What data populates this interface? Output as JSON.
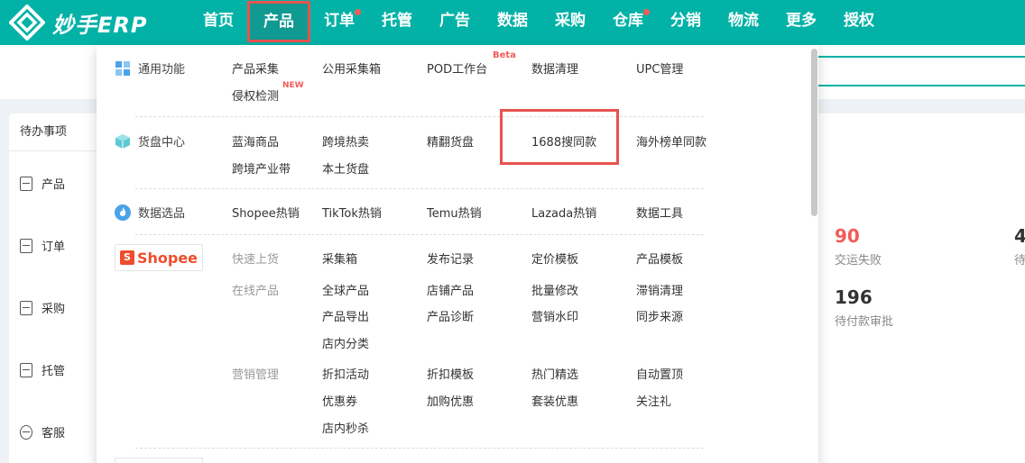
{
  "app": {
    "name": "妙手ERP"
  },
  "nav": [
    {
      "label": "首页",
      "active": false,
      "dot": false
    },
    {
      "label": "产品",
      "active": true,
      "dot": false
    },
    {
      "label": "订单",
      "active": false,
      "dot": true
    },
    {
      "label": "托管",
      "active": false,
      "dot": false
    },
    {
      "label": "广告",
      "active": false,
      "dot": false
    },
    {
      "label": "数据",
      "active": false,
      "dot": false
    },
    {
      "label": "采购",
      "active": false,
      "dot": false
    },
    {
      "label": "仓库",
      "active": false,
      "dot": true
    },
    {
      "label": "分销",
      "active": false,
      "dot": false
    },
    {
      "label": "物流",
      "active": false,
      "dot": false
    },
    {
      "label": "更多",
      "active": false,
      "dot": false
    },
    {
      "label": "授权",
      "active": false,
      "dot": false
    }
  ],
  "background": {
    "todo_title": "待办事项",
    "sidebar": [
      "产品",
      "订单",
      "采购",
      "托管",
      "客服"
    ],
    "stats": [
      {
        "value": "90",
        "label": "交运失败"
      },
      {
        "value": "4",
        "label": "待"
      },
      {
        "value": "196",
        "label": "待付款审批"
      }
    ]
  },
  "dropdown": {
    "categories": {
      "general": "通用功能",
      "supply": "货盘中心",
      "selection": "数据选品",
      "shopee": "Shopee"
    },
    "general_links": [
      "产品采集",
      "公用采集箱",
      "POD工作台",
      "数据清理",
      "UPC管理",
      "侵权检测"
    ],
    "badges": {
      "beta": "Beta",
      "new": "NEW"
    },
    "supply_links": [
      "蓝海商品",
      "跨境热卖",
      "精翻货盘",
      "1688搜同款",
      "海外榜单同款",
      "跨境产业带",
      "本土货盘"
    ],
    "selection_links": [
      "Shopee热销",
      "TikTok热销",
      "Temu热销",
      "Lazada热销",
      "数据工具"
    ],
    "shopee_section": {
      "quick_label": "快速上货",
      "quick_links": [
        "采集箱",
        "发布记录",
        "定价模板",
        "产品模板"
      ],
      "online_label": "在线产品",
      "online_links": [
        "全球产品",
        "店铺产品",
        "批量修改",
        "滞销清理",
        "产品导出",
        "产品诊断",
        "营销水印",
        "同步来源",
        "店内分类"
      ],
      "marketing_label": "营销管理",
      "marketing_links": [
        "折扣活动",
        "折扣模板",
        "热门精选",
        "自动置顶",
        "优惠券",
        "加购优惠",
        "套装优惠",
        "关注礼",
        "店内秒杀"
      ]
    }
  },
  "colors": {
    "brand": "#03b2a7",
    "highlight": "#e8534f",
    "alert": "#f35b59",
    "shopee": "#ee4d2d"
  }
}
